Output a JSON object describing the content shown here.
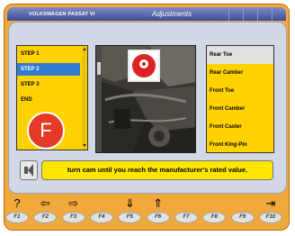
{
  "header": {
    "vehicle": "VOLKSWAGEN PASSAT VI",
    "screen_title": "Adjustments"
  },
  "steps": [
    {
      "label": "STEP 1",
      "selected": false
    },
    {
      "label": "STEP 2",
      "selected": true
    },
    {
      "label": "STEP 3",
      "selected": false
    },
    {
      "label": "END",
      "selected": false
    }
  ],
  "badge": {
    "letter": "F"
  },
  "adjustments": [
    {
      "label": "Rear Toe",
      "selected": true
    },
    {
      "label": "Rear Camber",
      "selected": false
    },
    {
      "label": "Front Toe",
      "selected": false
    },
    {
      "label": "Front Camber",
      "selected": false
    },
    {
      "label": "Front Caster",
      "selected": false
    },
    {
      "label": "Front King-Pin",
      "selected": false
    }
  ],
  "message": "turn cam until you reach the manufacturer's rated value.",
  "fkeys": [
    {
      "key": "F1",
      "icon": "help-icon",
      "glyph": "?"
    },
    {
      "key": "F2",
      "icon": "arrow-left-icon",
      "glyph": "⇦"
    },
    {
      "key": "F3",
      "icon": "arrow-right-icon",
      "glyph": "⇨"
    },
    {
      "key": "F4",
      "icon": "",
      "glyph": ""
    },
    {
      "key": "F5",
      "icon": "list-down-icon",
      "glyph": "⇓"
    },
    {
      "key": "F6",
      "icon": "list-up-icon",
      "glyph": "⇑"
    },
    {
      "key": "F7",
      "icon": "",
      "glyph": ""
    },
    {
      "key": "F8",
      "icon": "",
      "glyph": ""
    },
    {
      "key": "F9",
      "icon": "",
      "glyph": ""
    },
    {
      "key": "F10",
      "icon": "exit-icon",
      "glyph": "⇥"
    }
  ],
  "colors": {
    "frame": "#f2a93b",
    "panel_yellow": "#ffd200",
    "selected_blue": "#2f7bd0",
    "badge_red": "#e43a26",
    "title_blue": "#3c4d97"
  }
}
